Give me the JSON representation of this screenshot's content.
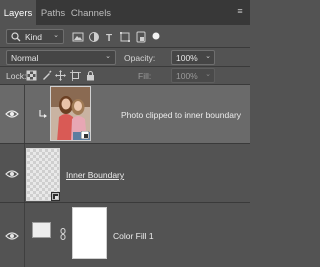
{
  "tabs": [
    {
      "label": "Layers"
    },
    {
      "label": "Paths"
    },
    {
      "label": "Channels"
    }
  ],
  "filter": {
    "kind_label": "Kind",
    "icons": [
      "image-filter-icon",
      "adjustment-filter-icon",
      "type-filter-icon",
      "shape-filter-icon",
      "smart-object-filter-icon",
      "filter-toggle-icon"
    ]
  },
  "blend": {
    "mode": "Normal",
    "opacity_label": "Opacity:",
    "opacity_value": "100%"
  },
  "lock": {
    "label": "Lock:",
    "icons": [
      "lock-transparent-pixels-icon",
      "lock-image-pixels-icon",
      "lock-position-icon",
      "lock-artboard-icon",
      "lock-all-icon"
    ],
    "fill_label": "Fill:",
    "fill_value": "100%"
  },
  "layers": [
    {
      "name": "Photo clipped to inner boundary",
      "selected": true,
      "visible": true,
      "clipped": true
    },
    {
      "name": "Inner Boundary",
      "selected": false,
      "visible": true,
      "underlined": true
    },
    {
      "name": "Color Fill 1",
      "selected": false,
      "visible": true
    }
  ],
  "colors": {
    "panel_bg": "#535353",
    "tab_bar_bg": "#383838",
    "selected_layer_bg": "#6a6a6a",
    "text": "#ececec"
  }
}
